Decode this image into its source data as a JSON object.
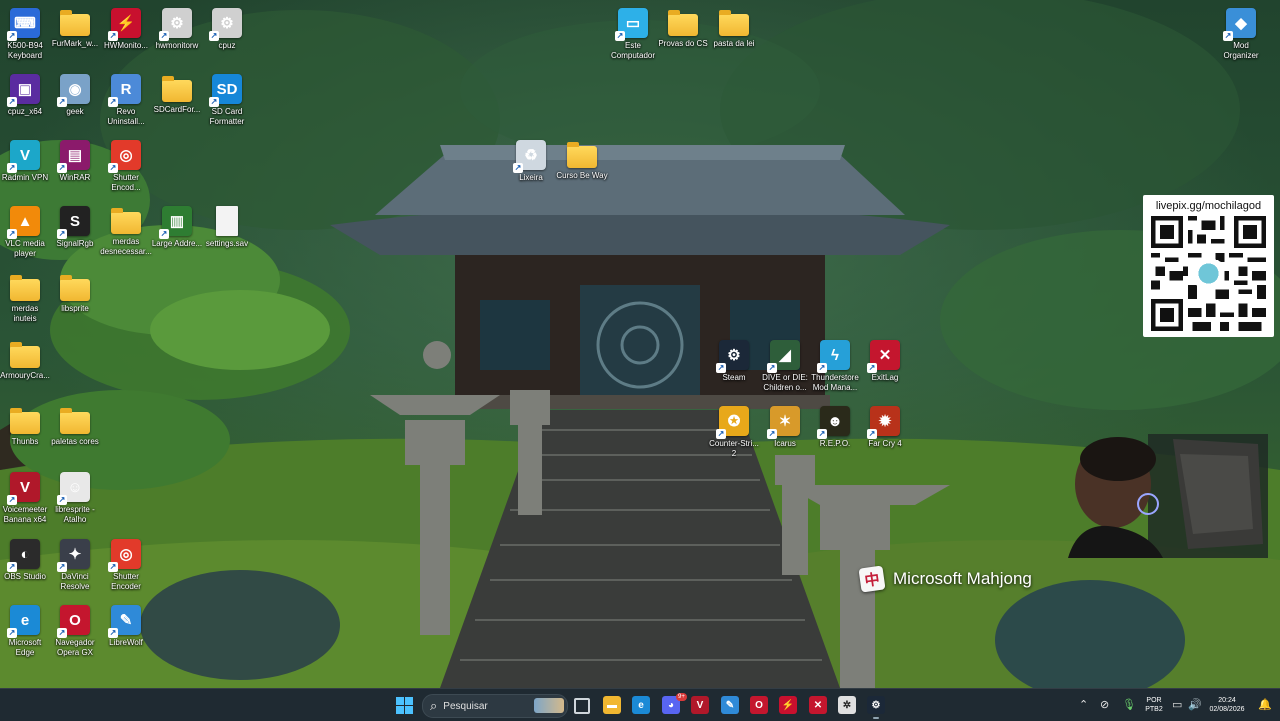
{
  "desktop": {
    "icons": [
      {
        "label": "K500-B94 Keyboard",
        "icon": "keyboard-app-icon",
        "color": "#2a6ad8"
      },
      {
        "label": "FurMark_w...",
        "icon": "folder-icon",
        "color": "#f1b731"
      },
      {
        "label": "HWMonito...",
        "icon": "hwmonitor-icon",
        "color": "#c8102e"
      },
      {
        "label": "hwmonitorw",
        "icon": "gear-file-icon",
        "color": "#d0d0d0"
      },
      {
        "label": "cpuz",
        "icon": "gear-file-icon",
        "color": "#d0d0d0"
      },
      {
        "label": "Este Computador",
        "icon": "monitor-icon",
        "color": "#2db0e8"
      },
      {
        "label": "Provas do CS",
        "icon": "folder-icon",
        "color": "#f1b731"
      },
      {
        "label": "pasta da lei",
        "icon": "folder-icon",
        "color": "#f1b731"
      },
      {
        "label": "Mod Organizer",
        "icon": "mod-organizer-icon",
        "color": "#3a8fd8"
      },
      {
        "label": "cpuz_x64",
        "icon": "cpuz-icon",
        "color": "#5a2ca0"
      },
      {
        "label": "geek",
        "icon": "geek-icon",
        "color": "#7aa2c8"
      },
      {
        "label": "Revo Uninstall...",
        "icon": "revo-icon",
        "color": "#4c8ad8"
      },
      {
        "label": "SDCardFor...",
        "icon": "folder-icon",
        "color": "#f1b731"
      },
      {
        "label": "SD Card Formatter",
        "icon": "sd-card-icon",
        "color": "#1687d8"
      },
      {
        "label": "Lixeira",
        "icon": "recycle-bin-icon",
        "color": "#cfd8e0"
      },
      {
        "label": "Curso Be Way",
        "icon": "folder-icon",
        "color": "#f1b731"
      },
      {
        "label": "Radmin VPN",
        "icon": "radmin-icon",
        "color": "#1ca7c9"
      },
      {
        "label": "WinRAR",
        "icon": "winrar-icon",
        "color": "#8b1a6b"
      },
      {
        "label": "Shutter Encod...",
        "icon": "shutter-icon",
        "color": "#e23a2a"
      },
      {
        "label": "VLC media player",
        "icon": "vlc-icon",
        "color": "#f28a0a"
      },
      {
        "label": "SignalRgb",
        "icon": "signalrgb-icon",
        "color": "#222222"
      },
      {
        "label": "merdas desnecessar...",
        "icon": "folder-icon",
        "color": "#f1b731"
      },
      {
        "label": "Large Addre...",
        "icon": "large-address-icon",
        "color": "#2e7d32"
      },
      {
        "label": "settings.sav",
        "icon": "file-icon",
        "color": "#f3f3f3"
      },
      {
        "label": "merdas inuteis",
        "icon": "folder-icon",
        "color": "#f1b731"
      },
      {
        "label": "libsprite",
        "icon": "folder-icon",
        "color": "#f1b731"
      },
      {
        "label": "ArmouryCra...",
        "icon": "folder-icon",
        "color": "#f1b731"
      },
      {
        "label": "Thunbs",
        "icon": "folder-icon",
        "color": "#f1b731"
      },
      {
        "label": "paletas cores",
        "icon": "folder-icon",
        "color": "#f1b731"
      },
      {
        "label": "Voicemeeter Banana x64",
        "icon": "voicemeeter-icon",
        "color": "#b0182a"
      },
      {
        "label": "libresprite - Atalho",
        "icon": "libresprite-icon",
        "color": "#e8e8e8"
      },
      {
        "label": "OBS Studio",
        "icon": "obs-icon",
        "color": "#2b2b2b"
      },
      {
        "label": "DaVinci Resolve",
        "icon": "davinci-icon",
        "color": "#3a3f4a"
      },
      {
        "label": "Shutter Encoder",
        "icon": "shutter-icon",
        "color": "#e23a2a"
      },
      {
        "label": "Microsoft Edge",
        "icon": "edge-icon",
        "color": "#1b8ad6"
      },
      {
        "label": "Navegador Opera GX",
        "icon": "opera-gx-icon",
        "color": "#c4162e"
      },
      {
        "label": "LibreWolf",
        "icon": "librewolf-icon",
        "color": "#2f8ad8"
      },
      {
        "label": "Steam",
        "icon": "steam-icon",
        "color": "#1b2838"
      },
      {
        "label": "DIVE or DIE: Children o...",
        "icon": "game-icon",
        "color": "#2e5e3a"
      },
      {
        "label": "Thunderstore Mod Mana...",
        "icon": "thunderstore-icon",
        "color": "#26a0d8"
      },
      {
        "label": "ExitLag",
        "icon": "exitlag-icon",
        "color": "#c4162e"
      },
      {
        "label": "Counter-Stri... 2",
        "icon": "cs2-icon",
        "color": "#e8a81a"
      },
      {
        "label": "Icarus",
        "icon": "icarus-icon",
        "color": "#d89a2a"
      },
      {
        "label": "R.E.P.O.",
        "icon": "repo-icon",
        "color": "#2a2a1a"
      },
      {
        "label": "Far Cry 4",
        "icon": "farcry-icon",
        "color": "#b8321a"
      }
    ]
  },
  "overlay": {
    "qr_caption": "livepix.gg/mochilagod",
    "notification": "Microsoft Mahjong"
  },
  "taskbar": {
    "search_placeholder": "Pesquisar",
    "apps": [
      {
        "name": "file-explorer-icon",
        "color": "#f1b731"
      },
      {
        "name": "edge-icon",
        "color": "#1b8ad6"
      },
      {
        "name": "discord-icon",
        "color": "#5865f2"
      },
      {
        "name": "voicemeeter-icon",
        "color": "#b0182a"
      },
      {
        "name": "librewolf-icon",
        "color": "#2f8ad8"
      },
      {
        "name": "opera-gx-icon",
        "color": "#c4162e"
      },
      {
        "name": "hwmonitor-icon",
        "color": "#c8102e"
      },
      {
        "name": "exitlag-icon",
        "color": "#c4162e"
      },
      {
        "name": "chatgpt-icon",
        "color": "#e0e0e0"
      },
      {
        "name": "steam-icon",
        "color": "#1b2838"
      }
    ],
    "discord_badge": "9+",
    "language": "POR",
    "layout": "PTB2",
    "time": "20:24",
    "date": "02/08/2026"
  },
  "colors": {
    "taskbar": "#1f2a32",
    "accent": "#4cc2ff"
  }
}
